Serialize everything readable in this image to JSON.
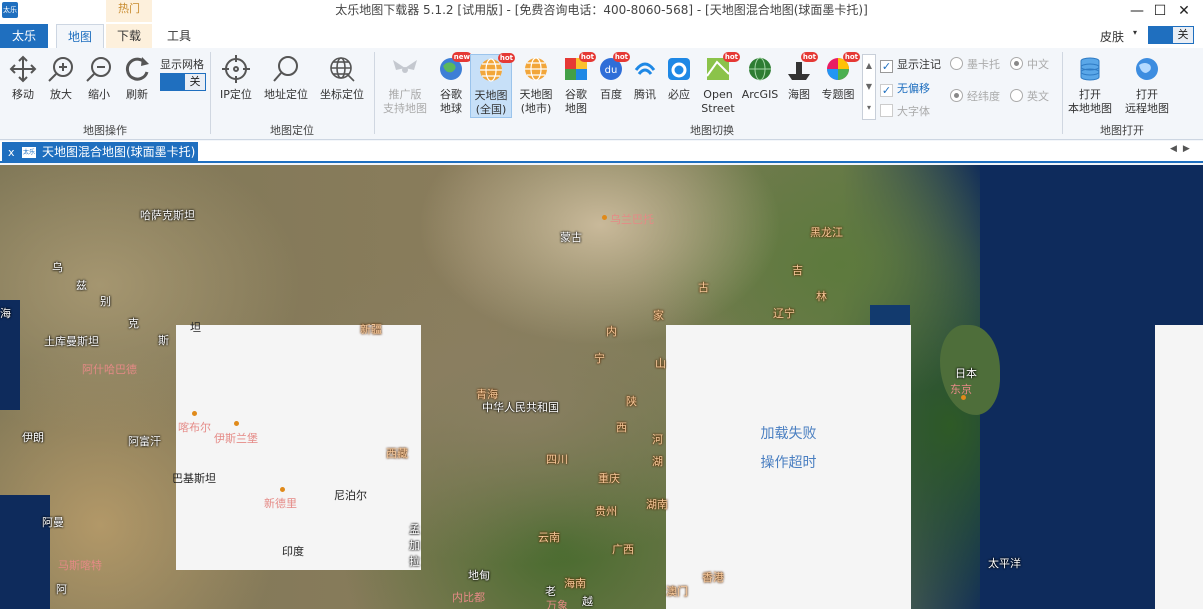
{
  "window": {
    "app_icon_text": "太乐",
    "title": "太乐地图下载器 5.1.2 [试用版] - [免费咨询电话：400-8060-568] - [天地图混合地图(球面墨卡托)]",
    "hot_label": "热门",
    "minimize": "—",
    "maximize": "☐",
    "close": "✕"
  },
  "menu": {
    "tabs": [
      "太乐",
      "地图",
      "下载",
      "工具"
    ],
    "skin_label": "皮肤",
    "skin_arrow": "▾",
    "skin_toggle": "关"
  },
  "ribbon": {
    "map_ops": {
      "label": "地图操作",
      "move": "移动",
      "zoom_in": "放大",
      "zoom_out": "缩小",
      "refresh": "刷新",
      "grid_label": "显示网格",
      "grid_toggle": "关"
    },
    "map_locate": {
      "label": "地图定位",
      "ip": "IP定位",
      "address": "地址定位",
      "coord": "坐标定位"
    },
    "map_switch": {
      "label": "地图切换",
      "promo_line1": "推广版",
      "promo_line2": "支持地图",
      "google_earth_line1": "谷歌",
      "google_earth_line2": "地球",
      "tdt_all_line1": "天地图",
      "tdt_all_line2": "(全国)",
      "tdt_city_line1": "天地图",
      "tdt_city_line2": "(地市)",
      "google_map_line1": "谷歌",
      "google_map_line2": "地图",
      "baidu": "百度",
      "tencent": "腾讯",
      "bing": "必应",
      "osm_line1": "Open",
      "osm_line2": "Street",
      "arcgis": "ArcGIS",
      "sea": "海图",
      "topic": "专题图",
      "badge_new": "new",
      "badge_hot": "hot",
      "badge_du": "du",
      "scroll_up": "▲",
      "scroll_down": "▼",
      "scroll_more": "▾",
      "show_annotation": "显示注记",
      "check_mark": "✓",
      "no_offset": "无偏移",
      "large_font": "大字体",
      "mercator": "墨卡托",
      "latlon": "经纬度",
      "chinese": "中文",
      "english": "英文"
    },
    "map_open": {
      "label": "地图打开",
      "local_line1": "打开",
      "local_line2": "本地地图",
      "remote_line1": "打开",
      "remote_line2": "远程地图"
    }
  },
  "doc_tab": {
    "close": "x",
    "icon_text": "太乐",
    "label": "天地图混合地图(球面墨卡托)",
    "arrows": "◀▶"
  },
  "map": {
    "fail_line1": "加载失败",
    "fail_line2": "操作超时",
    "labels": [
      "哈萨克斯坦",
      "乌兰巴托",
      "蒙古",
      "黑龙江",
      "吉",
      "林",
      "辽宁",
      "古",
      "家",
      "内",
      "宁",
      "陕",
      "山",
      "西",
      "河",
      "湖",
      "新疆",
      "青海",
      "中华人民共和国",
      "四川",
      "重庆",
      "湖南",
      "贵州",
      "云南",
      "广西",
      "海南",
      "越",
      "老",
      "地甸",
      "万象",
      "内比都",
      "澳门",
      "香港",
      "西藏",
      "喀布尔",
      "伊斯兰堡",
      "巴基斯坦",
      "新德里",
      "尼泊尔",
      "印度",
      "孟",
      "加",
      "拉",
      "阿富汗",
      "伊朗",
      "土库曼斯坦",
      "阿什哈巴德",
      "乌",
      "兹",
      "别",
      "克",
      "斯",
      "坦",
      "海",
      "阿曼",
      "马斯喀特",
      "阿",
      "日本",
      "东京",
      "太平洋"
    ]
  }
}
